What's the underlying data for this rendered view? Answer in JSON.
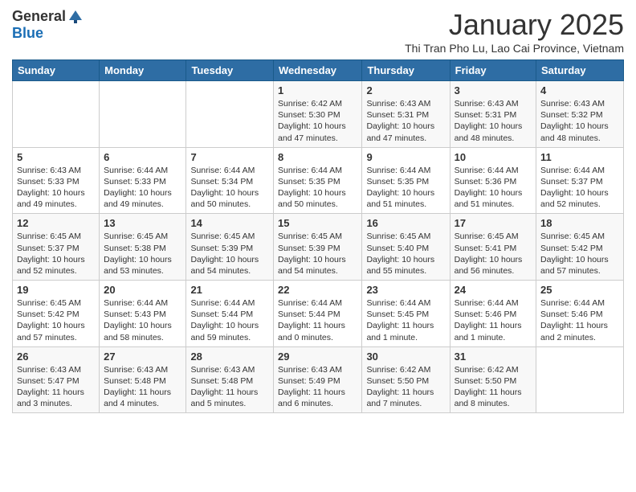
{
  "logo": {
    "general": "General",
    "blue": "Blue"
  },
  "title": "January 2025",
  "subtitle": "Thi Tran Pho Lu, Lao Cai Province, Vietnam",
  "days_of_week": [
    "Sunday",
    "Monday",
    "Tuesday",
    "Wednesday",
    "Thursday",
    "Friday",
    "Saturday"
  ],
  "weeks": [
    [
      {
        "day": "",
        "info": ""
      },
      {
        "day": "",
        "info": ""
      },
      {
        "day": "",
        "info": ""
      },
      {
        "day": "1",
        "info": "Sunrise: 6:42 AM\nSunset: 5:30 PM\nDaylight: 10 hours\nand 47 minutes."
      },
      {
        "day": "2",
        "info": "Sunrise: 6:43 AM\nSunset: 5:31 PM\nDaylight: 10 hours\nand 47 minutes."
      },
      {
        "day": "3",
        "info": "Sunrise: 6:43 AM\nSunset: 5:31 PM\nDaylight: 10 hours\nand 48 minutes."
      },
      {
        "day": "4",
        "info": "Sunrise: 6:43 AM\nSunset: 5:32 PM\nDaylight: 10 hours\nand 48 minutes."
      }
    ],
    [
      {
        "day": "5",
        "info": "Sunrise: 6:43 AM\nSunset: 5:33 PM\nDaylight: 10 hours\nand 49 minutes."
      },
      {
        "day": "6",
        "info": "Sunrise: 6:44 AM\nSunset: 5:33 PM\nDaylight: 10 hours\nand 49 minutes."
      },
      {
        "day": "7",
        "info": "Sunrise: 6:44 AM\nSunset: 5:34 PM\nDaylight: 10 hours\nand 50 minutes."
      },
      {
        "day": "8",
        "info": "Sunrise: 6:44 AM\nSunset: 5:35 PM\nDaylight: 10 hours\nand 50 minutes."
      },
      {
        "day": "9",
        "info": "Sunrise: 6:44 AM\nSunset: 5:35 PM\nDaylight: 10 hours\nand 51 minutes."
      },
      {
        "day": "10",
        "info": "Sunrise: 6:44 AM\nSunset: 5:36 PM\nDaylight: 10 hours\nand 51 minutes."
      },
      {
        "day": "11",
        "info": "Sunrise: 6:44 AM\nSunset: 5:37 PM\nDaylight: 10 hours\nand 52 minutes."
      }
    ],
    [
      {
        "day": "12",
        "info": "Sunrise: 6:45 AM\nSunset: 5:37 PM\nDaylight: 10 hours\nand 52 minutes."
      },
      {
        "day": "13",
        "info": "Sunrise: 6:45 AM\nSunset: 5:38 PM\nDaylight: 10 hours\nand 53 minutes."
      },
      {
        "day": "14",
        "info": "Sunrise: 6:45 AM\nSunset: 5:39 PM\nDaylight: 10 hours\nand 54 minutes."
      },
      {
        "day": "15",
        "info": "Sunrise: 6:45 AM\nSunset: 5:39 PM\nDaylight: 10 hours\nand 54 minutes."
      },
      {
        "day": "16",
        "info": "Sunrise: 6:45 AM\nSunset: 5:40 PM\nDaylight: 10 hours\nand 55 minutes."
      },
      {
        "day": "17",
        "info": "Sunrise: 6:45 AM\nSunset: 5:41 PM\nDaylight: 10 hours\nand 56 minutes."
      },
      {
        "day": "18",
        "info": "Sunrise: 6:45 AM\nSunset: 5:42 PM\nDaylight: 10 hours\nand 57 minutes."
      }
    ],
    [
      {
        "day": "19",
        "info": "Sunrise: 6:45 AM\nSunset: 5:42 PM\nDaylight: 10 hours\nand 57 minutes."
      },
      {
        "day": "20",
        "info": "Sunrise: 6:44 AM\nSunset: 5:43 PM\nDaylight: 10 hours\nand 58 minutes."
      },
      {
        "day": "21",
        "info": "Sunrise: 6:44 AM\nSunset: 5:44 PM\nDaylight: 10 hours\nand 59 minutes."
      },
      {
        "day": "22",
        "info": "Sunrise: 6:44 AM\nSunset: 5:44 PM\nDaylight: 11 hours\nand 0 minutes."
      },
      {
        "day": "23",
        "info": "Sunrise: 6:44 AM\nSunset: 5:45 PM\nDaylight: 11 hours\nand 1 minute."
      },
      {
        "day": "24",
        "info": "Sunrise: 6:44 AM\nSunset: 5:46 PM\nDaylight: 11 hours\nand 1 minute."
      },
      {
        "day": "25",
        "info": "Sunrise: 6:44 AM\nSunset: 5:46 PM\nDaylight: 11 hours\nand 2 minutes."
      }
    ],
    [
      {
        "day": "26",
        "info": "Sunrise: 6:43 AM\nSunset: 5:47 PM\nDaylight: 11 hours\nand 3 minutes."
      },
      {
        "day": "27",
        "info": "Sunrise: 6:43 AM\nSunset: 5:48 PM\nDaylight: 11 hours\nand 4 minutes."
      },
      {
        "day": "28",
        "info": "Sunrise: 6:43 AM\nSunset: 5:48 PM\nDaylight: 11 hours\nand 5 minutes."
      },
      {
        "day": "29",
        "info": "Sunrise: 6:43 AM\nSunset: 5:49 PM\nDaylight: 11 hours\nand 6 minutes."
      },
      {
        "day": "30",
        "info": "Sunrise: 6:42 AM\nSunset: 5:50 PM\nDaylight: 11 hours\nand 7 minutes."
      },
      {
        "day": "31",
        "info": "Sunrise: 6:42 AM\nSunset: 5:50 PM\nDaylight: 11 hours\nand 8 minutes."
      },
      {
        "day": "",
        "info": ""
      }
    ]
  ]
}
